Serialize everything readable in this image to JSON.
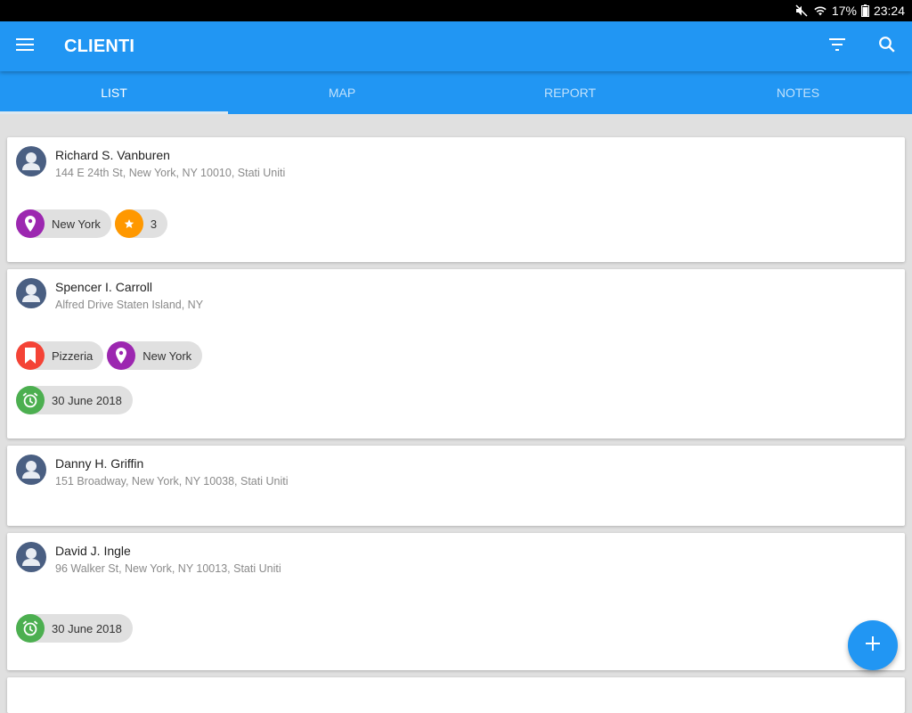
{
  "statusbar": {
    "battery": "17%",
    "time": "23:24",
    "icons": [
      "mute-icon",
      "wifi-icon",
      "battery-icon"
    ]
  },
  "appbar": {
    "title": "CLIENTI",
    "menu_icon": "menu-icon",
    "actions": [
      "filter-icon",
      "search-icon"
    ]
  },
  "tabs": [
    {
      "label": "LIST",
      "active": true
    },
    {
      "label": "MAP",
      "active": false
    },
    {
      "label": "REPORT",
      "active": false
    },
    {
      "label": "NOTES",
      "active": false
    }
  ],
  "colors": {
    "primary": "#2196f3",
    "location": "#9c27b0",
    "rating": "#ff9800",
    "category": "#f44336",
    "alarm": "#4caf50",
    "avatar": "#4a5f82"
  },
  "clients": [
    {
      "name": "Richard S. Vanburen",
      "address": "144 E 24th St, New York, NY 10010, Stati Uniti",
      "chips": [
        {
          "type": "location",
          "icon": "location-pin-icon",
          "label": "New York"
        },
        {
          "type": "rating",
          "icon": "star-icon",
          "label": "3"
        }
      ]
    },
    {
      "name": "Spencer I. Carroll",
      "address": "Alfred Drive Staten Island, NY",
      "chips": [
        {
          "type": "category",
          "icon": "bookmark-icon",
          "label": "Pizzeria"
        },
        {
          "type": "location",
          "icon": "location-pin-icon",
          "label": "New York"
        }
      ],
      "reminder": {
        "icon": "alarm-icon",
        "label": "30 June 2018"
      }
    },
    {
      "name": "Danny H. Griffin",
      "address": "151 Broadway, New York, NY 10038, Stati Uniti"
    },
    {
      "name": "David J. Ingle",
      "address": "96 Walker St, New York, NY 10013, Stati Uniti",
      "reminder": {
        "icon": "alarm-icon",
        "label": "30 June 2018"
      }
    }
  ],
  "fab": {
    "icon": "add-icon"
  }
}
